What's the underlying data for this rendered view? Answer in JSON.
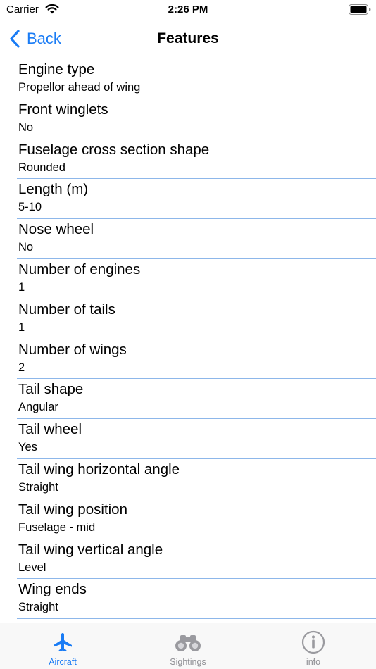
{
  "status_bar": {
    "carrier": "Carrier",
    "time": "2:26 PM"
  },
  "nav": {
    "back_label": "Back",
    "title": "Features"
  },
  "colors": {
    "accent": "#1a7cf5",
    "separator": "#8db7ea",
    "tab_inactive": "#8e8e93"
  },
  "features": [
    {
      "name": "Engine type",
      "value": "Propellor ahead of wing"
    },
    {
      "name": "Front winglets",
      "value": "No"
    },
    {
      "name": "Fuselage cross section shape",
      "value": "Rounded"
    },
    {
      "name": "Length (m)",
      "value": "5-10"
    },
    {
      "name": "Nose wheel",
      "value": "No"
    },
    {
      "name": "Number of engines",
      "value": "1"
    },
    {
      "name": "Number of tails",
      "value": "1"
    },
    {
      "name": "Number of wings",
      "value": "2"
    },
    {
      "name": "Tail shape",
      "value": "Angular"
    },
    {
      "name": "Tail wheel",
      "value": "Yes"
    },
    {
      "name": "Tail wing horizontal angle",
      "value": "Straight"
    },
    {
      "name": "Tail wing position",
      "value": "Fuselage - mid"
    },
    {
      "name": "Tail wing vertical angle",
      "value": "Level"
    },
    {
      "name": "Wing ends",
      "value": "Straight"
    }
  ],
  "tabs": [
    {
      "label": "Aircraft",
      "icon": "airplane-icon",
      "active": true
    },
    {
      "label": "Sightings",
      "icon": "binoculars-icon",
      "active": false
    },
    {
      "label": "info",
      "icon": "info-icon",
      "active": false
    }
  ]
}
